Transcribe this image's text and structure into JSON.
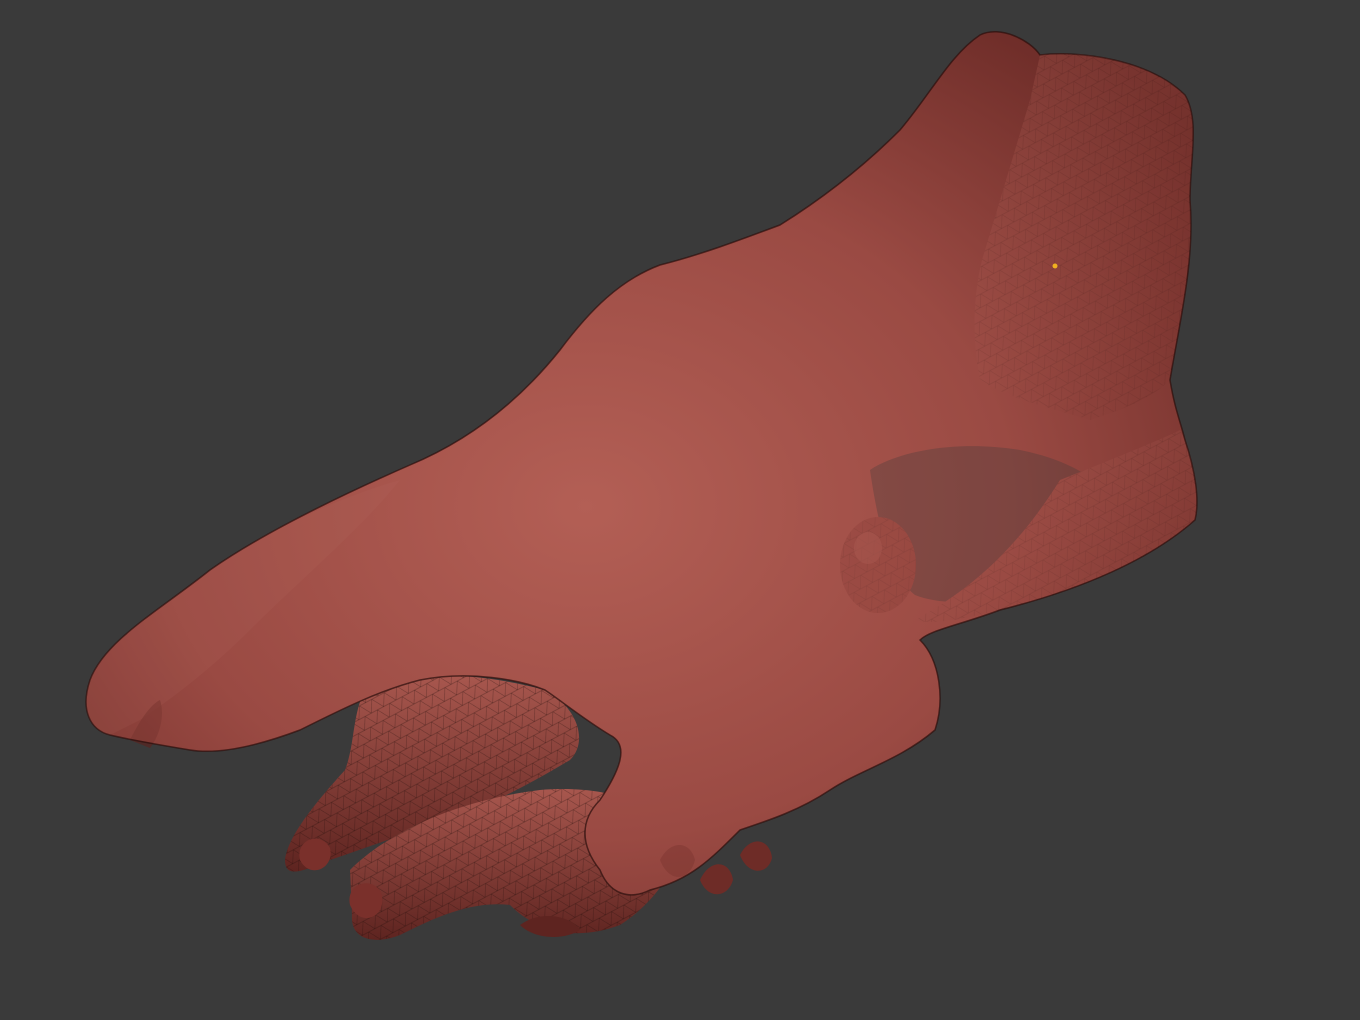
{
  "viewport": {
    "background_color": "#3a3a3a",
    "model": {
      "subject": "skull-mesh",
      "render_mode": "wireframe-on-shaded",
      "surface_color": "#a0504a",
      "shadow_color": "#5a2320",
      "highlight_color": "#c47a6f",
      "wire_color": "#1c0a08"
    },
    "marker": {
      "color": "#f0b020",
      "icon": "vertex-dot-icon"
    }
  }
}
